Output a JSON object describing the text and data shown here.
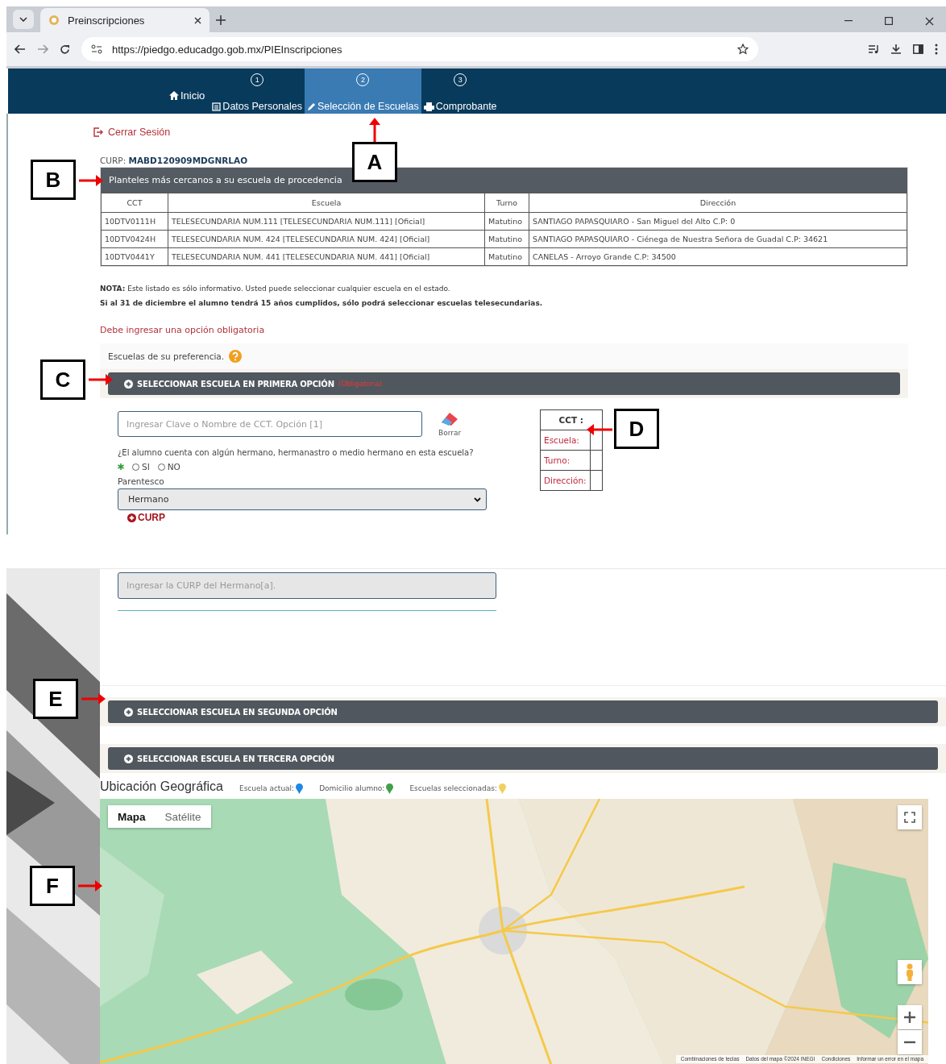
{
  "browser": {
    "tab_title": "Preinscripciones",
    "url": "https://piedgo.educadgo.gob.mx/PIEInscripciones"
  },
  "nav": {
    "home": "Inicio",
    "steps": [
      {
        "number": "1",
        "label": "Datos Personales",
        "kind": "form",
        "selected": false
      },
      {
        "number": "2",
        "label": "Selección de Escuelas",
        "kind": "pencil",
        "selected": true
      },
      {
        "number": "3",
        "label": "Comprobante",
        "kind": "print",
        "selected": false
      }
    ]
  },
  "logout": "Cerrar Sesión",
  "curp": {
    "label": "CURP:",
    "value": "MABD120909MDGNRLAO"
  },
  "nearby": {
    "title": "Planteles más cercanos a su escuela de procedencia",
    "columns": [
      "CCT",
      "Escuela",
      "Turno",
      "Dirección"
    ],
    "rows": [
      [
        "10DTV0111H",
        "TELESECUNDARIA NUM.111 [TELESECUNDARIA NUM.111] [Oficial]",
        "Matutino",
        "SANTIAGO PAPASQUIARO - San Miguel del Alto C.P: 0"
      ],
      [
        "10DTV0424H",
        "TELESECUNDARIA NUM. 424 [TELESECUNDARIA NUM. 424] [Oficial]",
        "Matutino",
        "SANTIAGO PAPASQUIARO - Ciénega de Nuestra Señora de Guadal C.P: 34621"
      ],
      [
        "10DTV0441Y",
        "TELESECUNDARIA NUM. 441 [TELESECUNDARIA NUM. 441] [Oficial]",
        "Matutino",
        "CANELAS - Arroyo Grande C.P: 34500"
      ]
    ]
  },
  "notes": [
    {
      "text": "**NOTA:** Este listado es sólo informativo. Usted puede seleccionar cualquier escuela en el estado.",
      "bold": false
    },
    {
      "text": "Si al 31 de diciembre el alumno tendrá 15 años cumplidos, sólo podrá seleccionar escuelas telesecundarias.",
      "bold": true
    }
  ],
  "required_message": "Debe ingresar una opción obligatoria",
  "preferences": "Escuelas de su preferencia.",
  "options": [
    {
      "title": "SELECCIONAR ESCUELA EN PRIMERA OPCIÓN",
      "tag": "(Obligatoria)"
    },
    {
      "title": "SELECCIONAR ESCUELA EN SEGUNDA OPCIÓN"
    },
    {
      "title": "SELECCIONAR ESCUELA EN TERCERA OPCIÓN"
    }
  ],
  "first_option": {
    "search_placeholder": "Ingresar Clave o Nombre de CCT. Opción [1]",
    "clear": "Borrar",
    "question": "¿El alumno cuenta con algún hermano, hermanastro o medio hermano en esta escuela?",
    "answers": [
      {
        "label": "SI",
        "selected": false
      },
      {
        "label": "NO",
        "selected": false
      }
    ],
    "relation_label": "Parentesco",
    "relation": "Hermano",
    "add_curp": "CURP",
    "curp_placeholder": "Ingresar la CURP del Hermano[a].",
    "details": [
      "CCT :",
      "Escuela:",
      "Turno:",
      "Dirección:"
    ]
  },
  "map": {
    "title": "Ubicación Geográfica",
    "legend": [
      {
        "label": "Escuela actual:",
        "color": "#1e88e5"
      },
      {
        "label": "Domicilio alumno:",
        "color": "#43a047"
      },
      {
        "label": "Escuelas seleccionadas:",
        "color": "#f0d060"
      }
    ],
    "map_types": [
      {
        "label": "Mapa",
        "selected": true
      },
      {
        "label": "Satélite",
        "selected": false
      }
    ],
    "attribution": [
      "Combinaciones de teclas",
      "Datos del mapa ©2024 INEGI",
      "Condiciones",
      "Informar un error en el mapa"
    ]
  },
  "callouts": [
    "A",
    "B",
    "C",
    "D",
    "E",
    "F"
  ]
}
